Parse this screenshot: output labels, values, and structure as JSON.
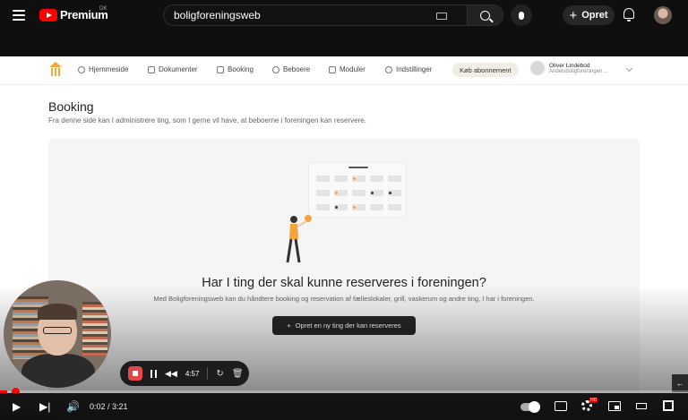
{
  "youtube": {
    "brand": "Premium",
    "country": "DK",
    "search_value": "boligforeningsweb",
    "create_label": "Opret"
  },
  "app": {
    "nav": [
      {
        "label": "Hjemmeside",
        "icon": "globe-icon"
      },
      {
        "label": "Dokumenter",
        "icon": "documents-icon"
      },
      {
        "label": "Booking",
        "icon": "calendar-icon"
      },
      {
        "label": "Beboere",
        "icon": "users-icon"
      },
      {
        "label": "Moduler",
        "icon": "cube-icon"
      },
      {
        "label": "Indstillinger",
        "icon": "gear-icon"
      }
    ],
    "subscribe_label": "Køb abonnement",
    "account_name": "Oliver Lindebod",
    "account_sub": "Andelsboligforeningen ..."
  },
  "page": {
    "title": "Booking",
    "description": "Fra denne side kan I administrere ting, som I gerne vil have, at beboerne i foreningen kan reservere."
  },
  "empty_state": {
    "title": "Har I ting der skal kunne reserveres i foreningen?",
    "description": "Med Boligforeningsweb kan du håndtere booking og reservation af fælleslokaler, grill, vaskerum og andre ting, I har i foreningen.",
    "cta_label": "Opret en ny ting der kan reserveres"
  },
  "recorder": {
    "elapsed": "4:57"
  },
  "player": {
    "time_display": "0:02 / 3:21",
    "progress": 0.01,
    "hd_badge": "HD"
  },
  "colors": {
    "accent": "#ff0000",
    "logo_orange": "#f3a43a"
  }
}
